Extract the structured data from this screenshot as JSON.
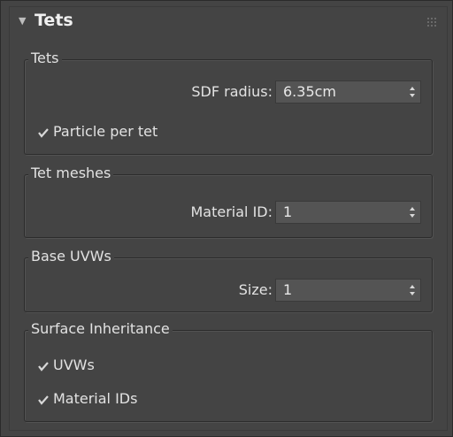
{
  "rollout": {
    "title": "Tets"
  },
  "groups": {
    "tets": {
      "title": "Tets",
      "sdf_radius": {
        "label": "SDF radius:",
        "value": "6.35cm"
      },
      "particle_per_tet": {
        "label": "Particle per tet",
        "checked": true
      }
    },
    "tet_meshes": {
      "title": "Tet meshes",
      "material_id": {
        "label": "Material ID:",
        "value": "1"
      }
    },
    "base_uvws": {
      "title": "Base UVWs",
      "size": {
        "label": "Size:",
        "value": "1"
      }
    },
    "surface_inheritance": {
      "title": "Surface Inheritance",
      "uvws": {
        "label": "UVWs",
        "checked": true
      },
      "material_ids": {
        "label": "Material IDs",
        "checked": true
      }
    }
  },
  "colors": {
    "panel_bg": "#444444",
    "spinner_bg": "#545454",
    "text": "#e2e2e2"
  }
}
